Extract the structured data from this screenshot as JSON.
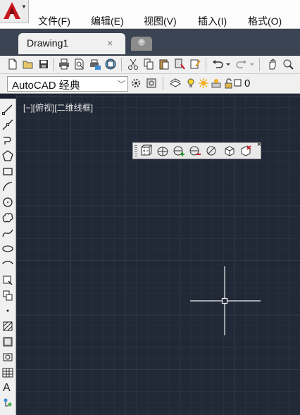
{
  "app": {
    "menu": [
      "文件(F)",
      "编辑(E)",
      "视图(V)",
      "插入(I)",
      "格式(O)"
    ]
  },
  "tabs": {
    "active_label": "Drawing1",
    "close_glyph": "×"
  },
  "workspace": {
    "value": "AutoCAD 经典"
  },
  "layer": {
    "name": "0"
  },
  "viewport": {
    "label": "[−][俯视][二维线框]"
  },
  "draw_toolbar": {
    "text_tool_glyph": "A"
  },
  "colors": {
    "canvas": "#212836",
    "grid_minor": "#283142",
    "grid_major": "#323b4e",
    "accent": "#c8171e"
  }
}
